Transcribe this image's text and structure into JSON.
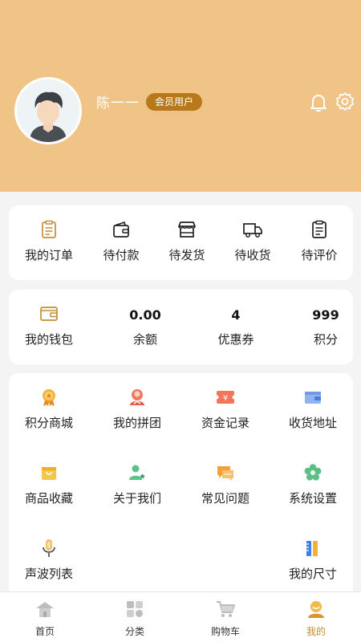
{
  "colors": {
    "header_bg": "#f0c486",
    "badge_bg": "#b7791c",
    "accent": "#c98b2d",
    "page_bg": "#f4f4f4"
  },
  "profile": {
    "name": "陈一一",
    "badge": "会员用户",
    "icons": [
      "bell-icon",
      "gear-icon"
    ]
  },
  "orders": [
    {
      "label": "我的订单",
      "icon": "clipboard-icon"
    },
    {
      "label": "待付款",
      "icon": "wallet-icon"
    },
    {
      "label": "待发货",
      "icon": "store-icon"
    },
    {
      "label": "待收货",
      "icon": "truck-icon"
    },
    {
      "label": "待评价",
      "icon": "notes-icon"
    }
  ],
  "wallet": {
    "label": "我的钱包",
    "balance": {
      "value": "0.00",
      "label": "余额"
    },
    "coupons": {
      "value": "4",
      "label": "优惠券"
    },
    "points": {
      "value": "999",
      "label": "积分"
    }
  },
  "services": [
    {
      "label": "积分商城",
      "icon": "medal-icon"
    },
    {
      "label": "我的拼团",
      "icon": "group-icon"
    },
    {
      "label": "资金记录",
      "icon": "money-ticket-icon"
    },
    {
      "label": "收货地址",
      "icon": "address-wallet-icon"
    },
    {
      "label": "商品收藏",
      "icon": "bag-icon"
    },
    {
      "label": "关于我们",
      "icon": "person-star-icon"
    },
    {
      "label": "常见问题",
      "icon": "chat-icon"
    },
    {
      "label": "系统设置",
      "icon": "flower-gear-icon"
    },
    {
      "label": "声波列表",
      "icon": "microphone-icon"
    },
    {
      "label": "我的尺寸",
      "icon": "ruler-icon"
    }
  ],
  "tabs": [
    {
      "label": "首页",
      "icon": "home-icon"
    },
    {
      "label": "分类",
      "icon": "category-icon"
    },
    {
      "label": "购物车",
      "icon": "cart-icon"
    },
    {
      "label": "我的",
      "icon": "profile-icon",
      "active": true
    }
  ]
}
